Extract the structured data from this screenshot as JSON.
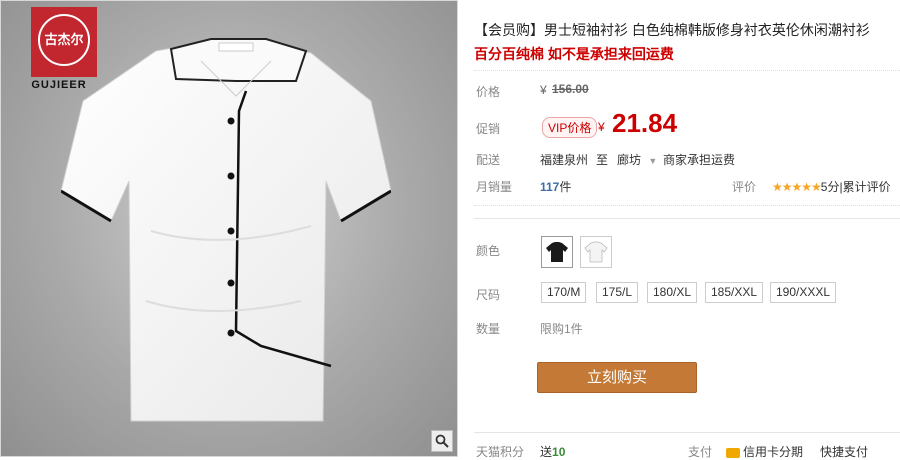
{
  "product_image": {
    "brand_logo_text": "古杰尔",
    "brand_name": "GUJIEER",
    "zoom_icon": "magnifier-icon"
  },
  "product": {
    "title": "【会员购】男士短袖衬衫 白色纯棉韩版修身衬衣英伦休闲潮衬衫",
    "subtitle": "百分百纯棉 如不是承担来回运费"
  },
  "price": {
    "original_label": "价格",
    "original_currency": "¥",
    "original_value": "156.00",
    "promo_label": "促销",
    "vip_badge": "VIP价格",
    "promo_currency": "¥",
    "promo_value": "21.84"
  },
  "shipping": {
    "label": "配送",
    "from": "福建泉州",
    "to_word": "至",
    "destination": "廊坊",
    "fee_text": "商家承担运费"
  },
  "sales": {
    "label": "月销量",
    "count": "117",
    "unit": "件",
    "rating_label": "评价",
    "stars": "★★★★★",
    "rating_text": "5分",
    "cumulative_text": "累计评价"
  },
  "options": {
    "color_label": "颜色",
    "colors": [
      "black-shirt",
      "white-shirt"
    ],
    "size_label": "尺码",
    "sizes": [
      "170/M",
      "175/L",
      "180/XL",
      "185/XXL",
      "190/XXXL"
    ],
    "quantity_label": "数量",
    "quantity_limit": "限购1件"
  },
  "actions": {
    "buy_now": "立刻购买"
  },
  "footer": {
    "points_label": "天猫积分",
    "points_prefix": "送",
    "points_value": "10",
    "payment_label": "支付",
    "credit_text": "信用卡分期",
    "quick_pay": "快捷支付"
  },
  "colors": {
    "accent_red": "#cc0000",
    "buy_button": "#c47a36",
    "logo_red": "#c2262e"
  }
}
